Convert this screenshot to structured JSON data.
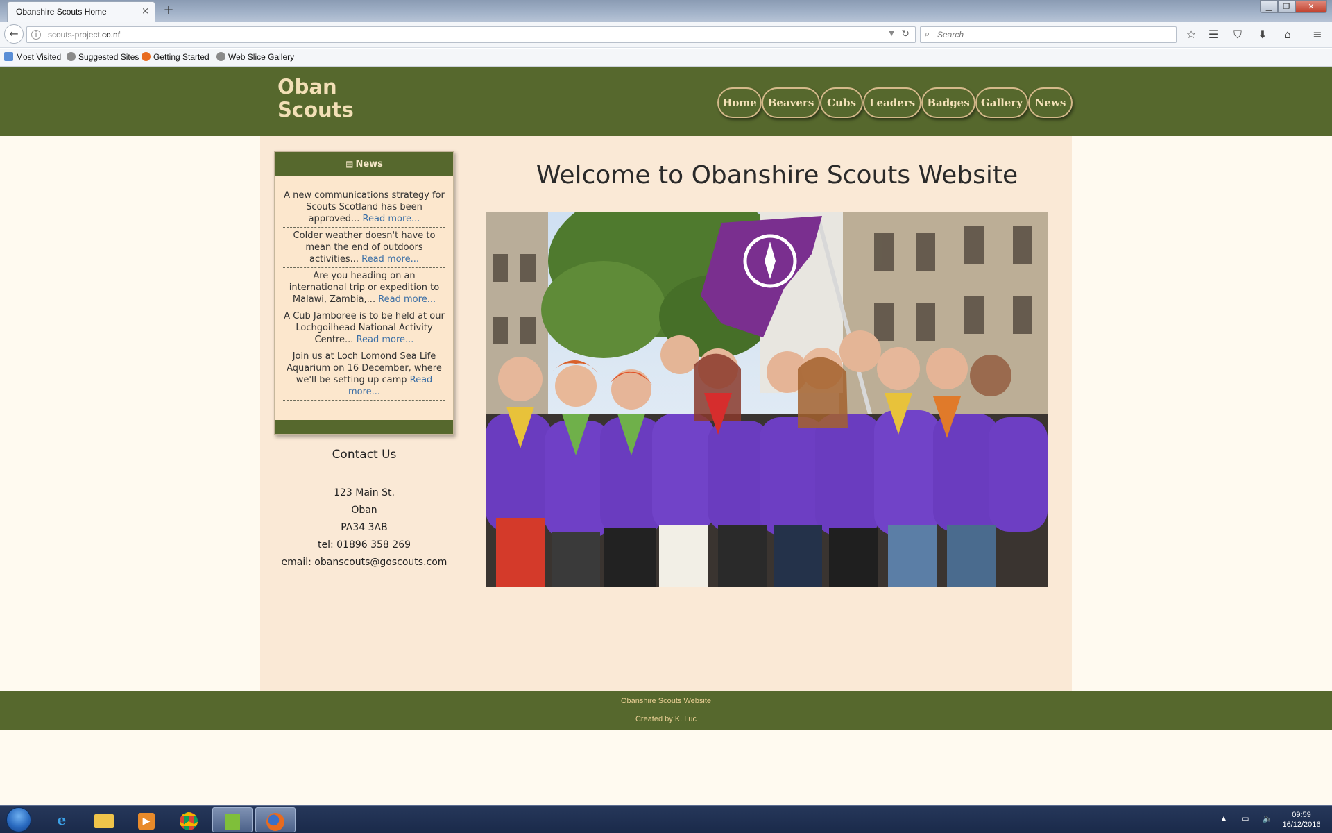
{
  "browser": {
    "tab_title": "Obanshire Scouts Home",
    "tab_close": "×",
    "new_tab": "+",
    "url_host": "scouts-project.",
    "url_domain": "co.nf",
    "search_placeholder": "Search",
    "bookmarks": [
      {
        "label": "Most Visited",
        "icon": "folder-icon",
        "color": "#5a8ed6"
      },
      {
        "label": "Suggested Sites",
        "icon": "globe-icon",
        "color": "#888888"
      },
      {
        "label": "Getting Started",
        "icon": "firefox-icon",
        "color": "#e86b1f"
      },
      {
        "label": "Web Slice Gallery",
        "icon": "globe-icon",
        "color": "#888888"
      }
    ]
  },
  "site": {
    "logo_line1": "Oban",
    "logo_line2": "Scouts",
    "nav": [
      "Home",
      "Beavers",
      "Cubs",
      "Leaders",
      "Badges",
      "Gallery",
      "News"
    ],
    "welcome": "Welcome to Obanshire Scouts Website",
    "news_title": "News",
    "news_icon": "newspaper-icon",
    "news": [
      {
        "text": "A new communications strategy for Scouts Scotland has been approved...",
        "link": "Read more..."
      },
      {
        "text": "Colder weather doesn't have to mean the end of outdoors activities...",
        "link": "Read more..."
      },
      {
        "text": "Are you heading on an international trip or expedition to Malawi, Zambia,...",
        "link": "Read more..."
      },
      {
        "text": "A Cub Jamboree is to be held at our Lochgoilhead National Activity Centre...",
        "link": "Read more..."
      },
      {
        "text": "Join us at Loch Lomond Sea Life Aquarium on 16 December, where we'll be setting up camp",
        "link": "Read more..."
      }
    ],
    "contact": {
      "title": "Contact Us",
      "lines": [
        "123 Main St.",
        "Oban",
        "PA34 3AB",
        "tel: 01896 358 269",
        "email: obanscouts@goscouts.com"
      ]
    },
    "footer": {
      "line1": "Obanshire Scouts Website",
      "line2": "Created by K. Luc"
    },
    "colors": {
      "brand_green": "#56682d",
      "cream": "#f2dfb6",
      "panel_bg": "#fae9d6",
      "link": "#3a6ea5",
      "scout_purple": "#6a3cbf"
    }
  },
  "taskbar": {
    "time": "09:59",
    "date": "16/12/2016",
    "apps": [
      "windows-start-icon",
      "internet-explorer-icon",
      "file-explorer-icon",
      "media-player-icon",
      "chrome-icon",
      "notepad-icon",
      "firefox-icon"
    ]
  }
}
